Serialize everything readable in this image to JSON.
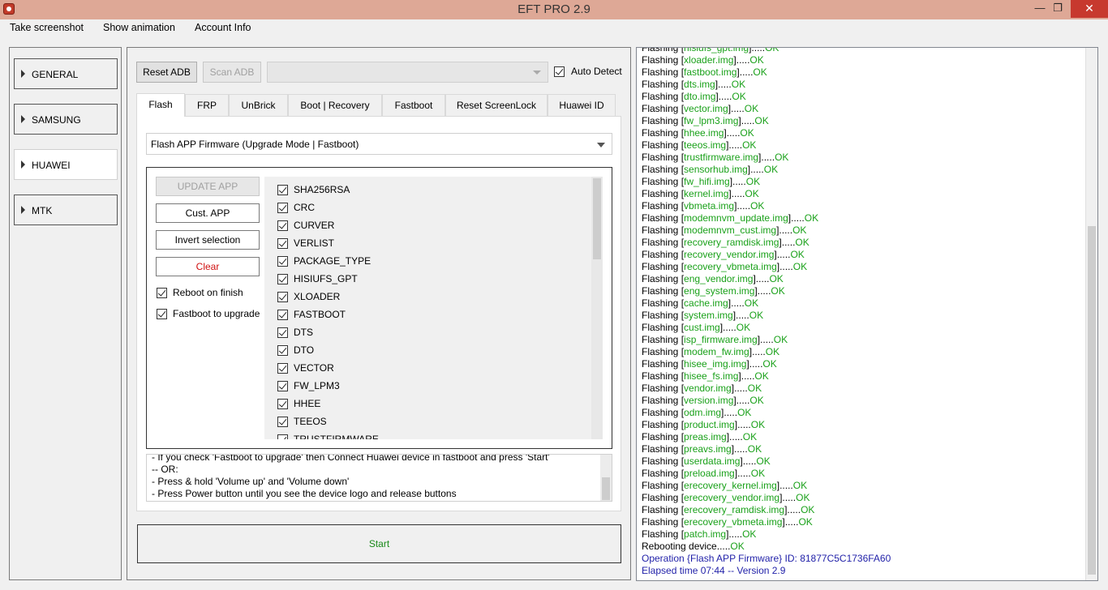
{
  "window": {
    "title": "EFT PRO 2.9",
    "controls": {
      "minimize": "—",
      "maximize": "❐",
      "close": "✕"
    }
  },
  "menu": [
    "Take screenshot",
    "Show animation",
    "Account Info"
  ],
  "nav": [
    {
      "label": "GENERAL",
      "active": false
    },
    {
      "label": "SAMSUNG",
      "active": false
    },
    {
      "label": "HUAWEI",
      "active": true
    },
    {
      "label": "MTK",
      "active": false
    }
  ],
  "toolbar": {
    "reset_adb": "Reset ADB",
    "scan_adb": "Scan ADB",
    "port_value": "",
    "auto_detect": "Auto Detect"
  },
  "tabs": [
    "Flash",
    "FRP",
    "UnBrick",
    "Boot | Recovery",
    "Fastboot",
    "Reset ScreenLock",
    "Huawei ID"
  ],
  "active_tab": "Flash",
  "flash": {
    "mode_selected": "Flash APP Firmware (Upgrade Mode | Fastboot)",
    "update_app": "UPDATE APP",
    "cust_app": "Cust. APP",
    "invert_selection": "Invert selection",
    "clear": "Clear",
    "reboot_on_finish": "Reboot on finish",
    "fastboot_to_upgrade": "Fastboot to upgrade",
    "partitions": [
      "SHA256RSA",
      "CRC",
      "CURVER",
      "VERLIST",
      "PACKAGE_TYPE",
      "HISIUFS_GPT",
      "XLOADER",
      "FASTBOOT",
      "DTS",
      "DTO",
      "VECTOR",
      "FW_LPM3",
      "HHEE",
      "TEEOS",
      "TRUSTFIRMWARE"
    ],
    "info_lines": [
      "- If you check 'Fastboot to upgrade' then Connect Huawei device in fastboot and press 'Start'",
      "-- OR:",
      "- Press & hold 'Volume up' and 'Volume down'",
      "- Press Power button until you see the device logo and release buttons"
    ],
    "start": "Start"
  },
  "log": {
    "prefix": "Flashing [",
    "suffix": "].....",
    "ok": "OK",
    "top_partial": "hisiufs_gpt.img",
    "files": [
      "xloader.img",
      "fastboot.img",
      "dts.img",
      "dto.img",
      "vector.img",
      "fw_lpm3.img",
      "hhee.img",
      "teeos.img",
      "trustfirmware.img",
      "sensorhub.img",
      "fw_hifi.img",
      "kernel.img",
      "vbmeta.img",
      "modemnvm_update.img",
      "modemnvm_cust.img",
      "recovery_ramdisk.img",
      "recovery_vendor.img",
      "recovery_vbmeta.img",
      "eng_vendor.img",
      "eng_system.img",
      "cache.img",
      "system.img",
      "cust.img",
      "isp_firmware.img",
      "modem_fw.img",
      "hisee_img.img",
      "hisee_fs.img",
      "vendor.img",
      "version.img",
      "odm.img",
      "product.img",
      "preas.img",
      "preavs.img",
      "userdata.img",
      "preload.img",
      "erecovery_kernel.img",
      "erecovery_vendor.img",
      "erecovery_ramdisk.img",
      "erecovery_vbmeta.img",
      "patch.img"
    ],
    "rebooting": "Rebooting device.....",
    "operation": "Operation {Flash APP Firmware} ID: 81877C5C1736FA60",
    "elapsed": "Elapsed time 07:44 -- Version 2.9"
  }
}
